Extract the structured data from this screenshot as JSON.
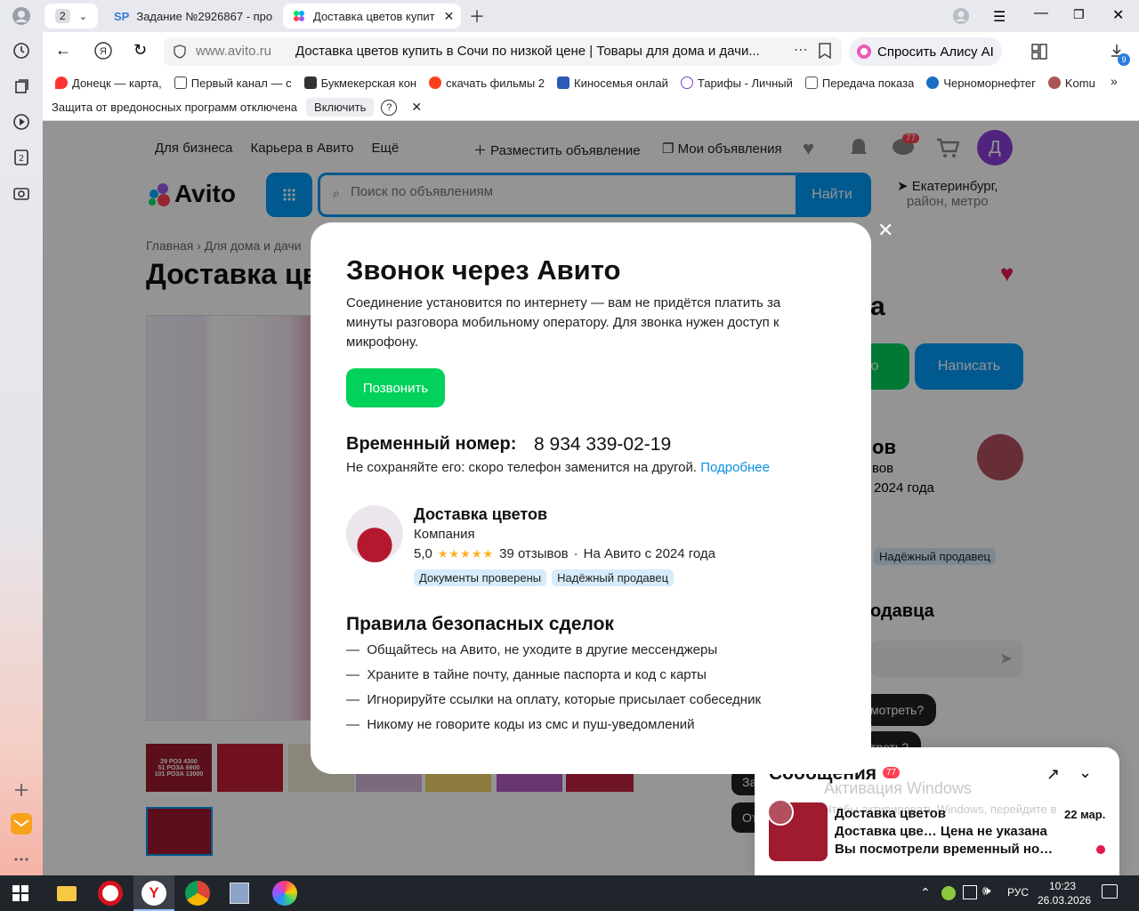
{
  "browser": {
    "tab_count": "2",
    "tabs": [
      {
        "label": "Задание №2926867 - про",
        "favicon_text": "SP"
      },
      {
        "label": "Доставка цветов купит"
      }
    ],
    "address_domain": "www.avito.ru",
    "page_title": "Доставка цветов купить в Сочи по низкой цене | Товары для дома и дачи...",
    "alice_button": "Спросить Алису AI",
    "downloads_count": "9",
    "bookmarks": [
      "Донецк — карта, ",
      "Первый канал — с",
      "Букмекерская кон",
      "скачать фильмы 2",
      "Киносемья онлай",
      "Тарифы - Личный",
      "Передача показа",
      "Черноморнефтег",
      "Komu"
    ],
    "infobar": {
      "text": "Защита от вредоносных программ отключена",
      "enable_button": "Включить",
      "help_icon": "?"
    }
  },
  "site": {
    "top_nav": [
      "Для бизнеса",
      "Карьера в Авито",
      "Ещё"
    ],
    "place_ad": "Разместить объявление",
    "my_ads": "Мои объявления",
    "messages_badge": "77",
    "avatar_letter": "Д",
    "logo": "Avito",
    "search_placeholder": "Поиск по объявлениям",
    "search_button": "Найти",
    "location_line1": "Екатеринбург,",
    "location_line2": "район, метро",
    "breadcrumb": [
      "Главная",
      "Для дома и дачи"
    ],
    "title_partial": "Доставка цв",
    "right_heading_partial": "а",
    "call_button_partial": "нто",
    "write_button": "Написать",
    "seller_partial_1": "ов",
    "seller_partial_2": "вов",
    "seller_partial_3": "2024 года",
    "reliable_badge": "Надёжный продавец",
    "ask_heading_partial": "одавца",
    "question_1_partial": "мотреть?",
    "question_2_partial": "треть?",
    "thumb_label_lines": [
      "29 РОЗ 4300",
      "51 РОЗА 6900",
      "101 РОЗА 13000"
    ]
  },
  "modal": {
    "title": "Звонок через Авито",
    "description": "Соединение установится по интернету — вам не придётся платить за минуты разговора мобильному оператору. Для звонка нужен доступ к микрофону.",
    "call_button": "Позвонить",
    "temp_label": "Временный номер:",
    "temp_number": "8 934 339-02-19",
    "note": "Не сохраняйте его: скоро телефон заменится на другой.",
    "more_link": "Подробнее",
    "seller": {
      "name": "Доставка цветов",
      "type": "Компания",
      "rating": "5,0",
      "stars": 5,
      "reviews": "39 отзывов",
      "since": "На Авито с 2024 года",
      "badges": [
        "Документы проверены",
        "Надёжный продавец"
      ]
    },
    "rules_title": "Правила безопасных сделок",
    "rules": [
      "Общайтесь на Авито, не уходите в другие мессенджеры",
      "Храните в тайне почту, данные паспорта и код с карты",
      "Игнорируйте ссылки на оплату, которые присылает собеседник",
      "Никому не говорите коды из смс и пуш-уведомлений"
    ]
  },
  "messages_panel": {
    "title": "Сообщения",
    "badge": "77",
    "chat_name": "Доставка цветов",
    "chat_date": "22 мар.",
    "chat_item": "Доставка цве…",
    "chat_price": "Цена не указана",
    "chat_preview": "Вы посмотрели временный но…",
    "windows_watermark_1": "Активация Windows",
    "windows_watermark_2": "Чтобы активировать Windows, перейдите в"
  },
  "left_partial_buttons": [
    "За",
    "От"
  ],
  "taskbar": {
    "language": "РУС",
    "time": "10:23",
    "date": "26.03.2026"
  },
  "colors": {
    "avito_green": "#02d15c",
    "avito_blue": "#0099f7",
    "link_blue": "#0a8ee0",
    "purple_avatar": "#8b3fd9",
    "star": "#ffb021"
  }
}
